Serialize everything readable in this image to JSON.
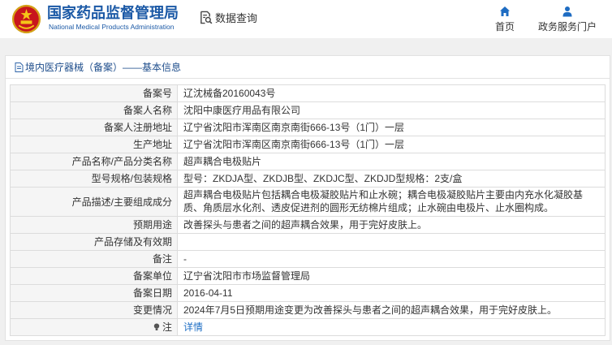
{
  "header": {
    "site_title": "国家药品监督管理局",
    "site_subtitle": "National Medical Products Administration",
    "logo_icon": "national-emblem-logo",
    "section_icon": "data-query-icon",
    "section_title": "数据查询",
    "nav": [
      {
        "label": "首页",
        "icon": "home-icon"
      },
      {
        "label": "政务服务门户",
        "icon": "user-icon"
      }
    ]
  },
  "panel": {
    "icon": "document-icon",
    "title": "境内医疗器械（备案）——基本信息"
  },
  "rows": [
    {
      "label": "备案号",
      "value": "辽沈械备20160043号"
    },
    {
      "label": "备案人名称",
      "value": "沈阳中康医疗用品有限公司"
    },
    {
      "label": "备案人注册地址",
      "value": "辽宁省沈阳市浑南区南京南街666-13号（1门）一层"
    },
    {
      "label": "生产地址",
      "value": "辽宁省沈阳市浑南区南京南街666-13号（1门）一层"
    },
    {
      "label": "产品名称/产品分类名称",
      "value": "超声耦合电极贴片"
    },
    {
      "label": "型号规格/包装规格",
      "value": "型号：ZKDJA型、ZKDJB型、ZKDJC型、ZKDJD型规格：2支/盒"
    },
    {
      "label": "产品描述/主要组成成分",
      "value": "超声耦合电极贴片包括耦合电极凝胶贴片和止水碗；耦合电极凝胶贴片主要由内充水化凝胶基质、角质层水化剂、透皮促进剂的圆形无纺棉片组成；止水碗由电极片、止水圈构成。"
    },
    {
      "label": "预期用途",
      "value": "改善探头与患者之间的超声耦合效果，用于完好皮肤上。"
    },
    {
      "label": "产品存储及有效期",
      "value": ""
    },
    {
      "label": "备注",
      "value": "-"
    },
    {
      "label": "备案单位",
      "value": "辽宁省沈阳市市场监督管理局"
    },
    {
      "label": "备案日期",
      "value": "2016-04-11"
    },
    {
      "label": "变更情况",
      "value": "2024年7月5日预期用途变更为改善探头与患者之间的超声耦合效果，用于完好皮肤上。"
    },
    {
      "label": "注",
      "icon": "bulb-icon",
      "value": "详情",
      "value_is_link": true
    }
  ],
  "colors": {
    "brand": "#1b59a6",
    "link": "#1f6fc5",
    "icon": "#1e6cc2",
    "panel_title": "#1f4e8c"
  }
}
